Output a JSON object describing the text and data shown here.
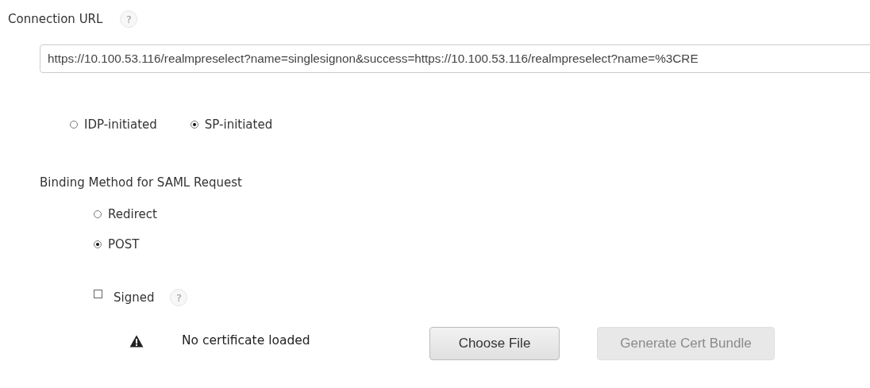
{
  "connection_url": {
    "label": "Connection URL",
    "help": "?",
    "value": "https://10.100.53.116/realmpreselect?name=singlesignon&success=https://10.100.53.116/realmpreselect?name=%3CRE"
  },
  "initiation": [
    {
      "label": "IDP-initiated",
      "selected": false
    },
    {
      "label": "SP-initiated",
      "selected": true
    }
  ],
  "binding": {
    "label": "Binding Method for SAML Request",
    "options": [
      {
        "label": "Redirect",
        "selected": false
      },
      {
        "label": "POST",
        "selected": true
      }
    ]
  },
  "signed": {
    "label": "Signed",
    "checked": false,
    "help": "?"
  },
  "certificate": {
    "status": "No certificate loaded",
    "buttons": [
      {
        "label": "Choose File",
        "disabled": false
      },
      {
        "label": "Generate Cert Bundle",
        "disabled": true
      }
    ]
  }
}
